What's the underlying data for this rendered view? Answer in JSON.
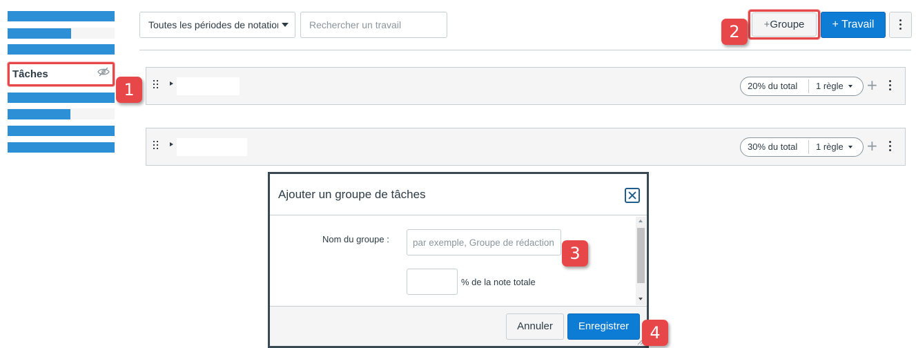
{
  "sidebar": {
    "active_item_label": "Tâches",
    "active_item_icon": "eye-slash-icon"
  },
  "toolbar": {
    "period_select_value": "Toutes les périodes de notation",
    "search_placeholder": "Rechercher un travail",
    "add_group_label": "Groupe",
    "add_assignment_label": "Travail",
    "add_icon": "plus-icon",
    "more_icon": "kebab-menu-icon"
  },
  "groups": [
    {
      "weight_label": "20% du total",
      "rules_label": "1 règle"
    },
    {
      "weight_label": "30% du total",
      "rules_label": "1 règle"
    }
  ],
  "modal": {
    "title": "Ajouter un groupe de tâches",
    "name_label": "Nom du groupe :",
    "name_placeholder": "par exemple, Groupe de rédaction",
    "percent_value": "",
    "percent_label": "% de la note totale",
    "cancel_label": "Annuler",
    "save_label": "Enregistrer"
  },
  "callouts": [
    "1",
    "2",
    "3",
    "4"
  ],
  "colors": {
    "primary": "#0c7cd5",
    "sidebar_bar": "#2d8fd5",
    "callout": "#e8474a",
    "text": "#2d3b45"
  }
}
